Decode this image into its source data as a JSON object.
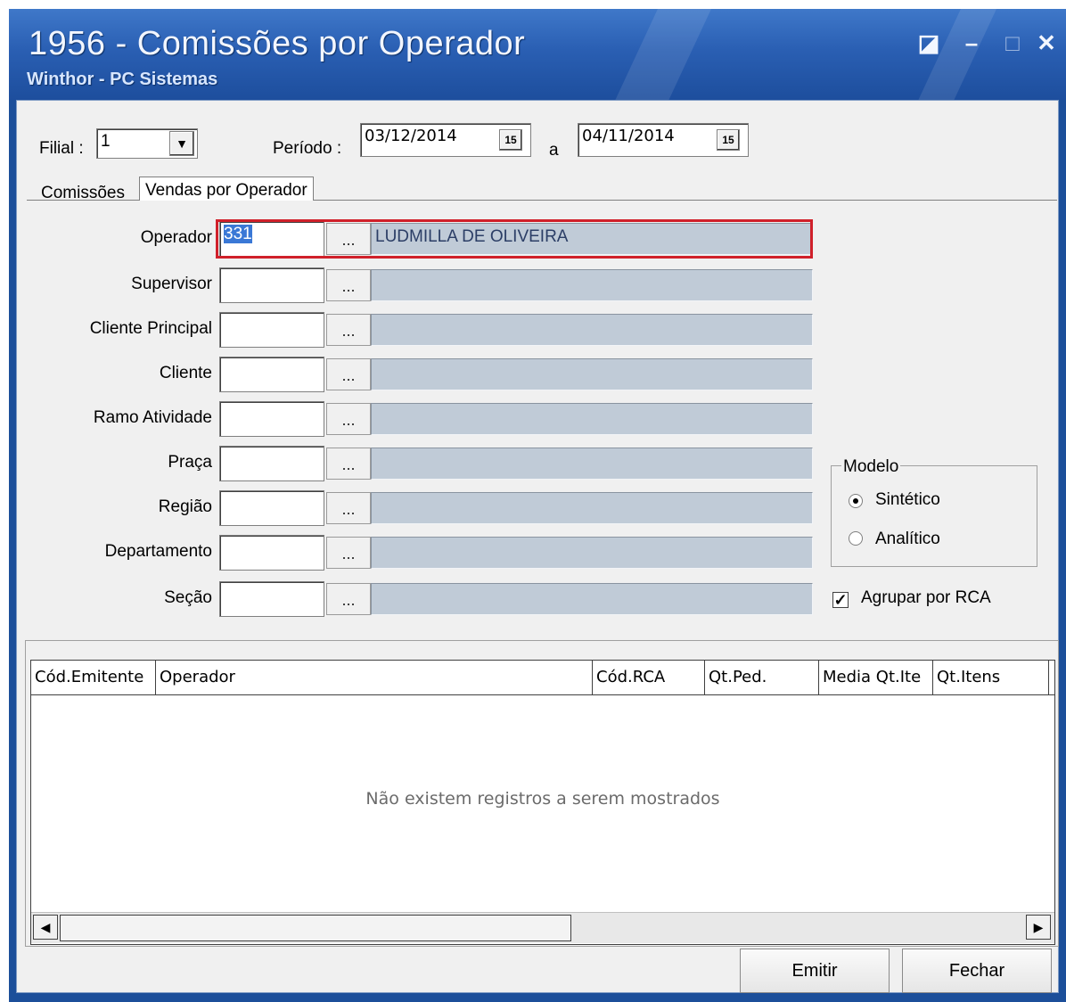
{
  "window": {
    "title": "1956 - Comissões por Operador",
    "subtitle": "Winthor - PC Sistemas",
    "controls": {
      "restore": "◪",
      "minimize": "–",
      "maximize": "□",
      "close": "✕"
    }
  },
  "filters": {
    "filial_label": "Filial :",
    "filial_value": "1",
    "periodo_label": "Período :",
    "date_from": "03/12/2014",
    "date_sep": "a",
    "date_to": "04/11/2014",
    "calendar_icon_text": "15"
  },
  "tabs": [
    {
      "label": "Comissões"
    },
    {
      "label": "Vendas por Operador"
    }
  ],
  "fields": [
    {
      "label": "Operador",
      "code": "331",
      "description": "LUDMILLA DE OLIVEIRA"
    },
    {
      "label": "Supervisor",
      "code": "",
      "description": ""
    },
    {
      "label": "Cliente Principal",
      "code": "",
      "description": ""
    },
    {
      "label": "Cliente",
      "code": "",
      "description": ""
    },
    {
      "label": "Ramo Atividade",
      "code": "",
      "description": ""
    },
    {
      "label": "Praça",
      "code": "",
      "description": ""
    },
    {
      "label": "Região",
      "code": "",
      "description": ""
    },
    {
      "label": "Departamento",
      "code": "",
      "description": ""
    },
    {
      "label": "Seção",
      "code": "",
      "description": ""
    }
  ],
  "lookup_button_text": "...",
  "modelo": {
    "title": "Modelo",
    "options": [
      {
        "label": "Sintético",
        "checked": true
      },
      {
        "label": "Analítico",
        "checked": false
      }
    ]
  },
  "agrupar": {
    "label": "Agrupar por RCA",
    "checked": true,
    "mark": "✓"
  },
  "grid": {
    "columns": [
      "Cód.Emitente",
      "Operador",
      "Cód.RCA",
      "Qt.Ped.",
      "Media Qt.Ite",
      "Qt.Itens"
    ],
    "empty_message": "Não existem registros a serem mostrados",
    "scroll_left": "◀",
    "scroll_right": "▶"
  },
  "buttons": {
    "emitir": "Emitir",
    "fechar": "Fechar"
  },
  "colors": {
    "title_bar": "#2a5fb3",
    "highlight": "#d0202a",
    "lookup_bg": "#c0cbd7"
  }
}
